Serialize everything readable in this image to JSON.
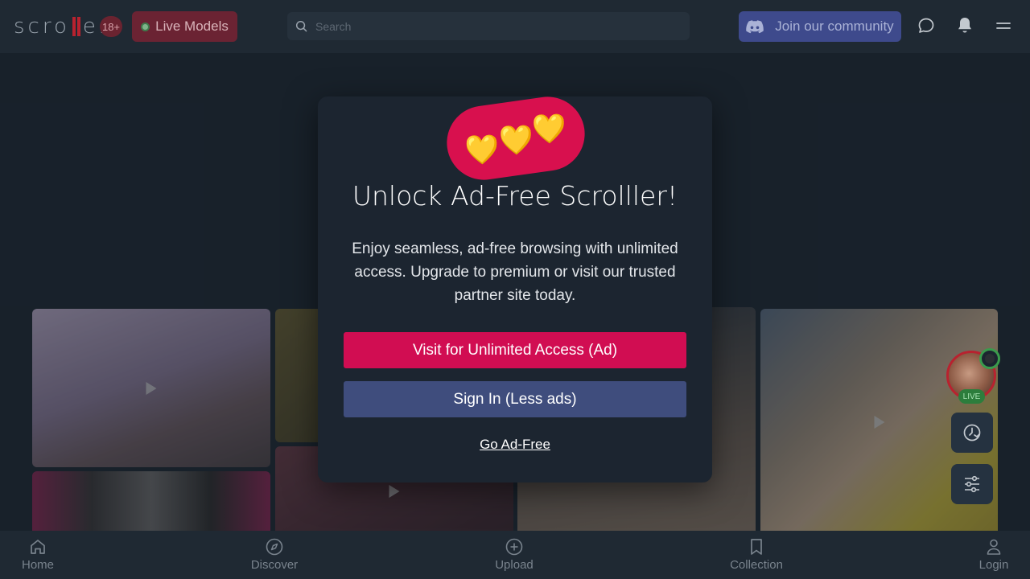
{
  "header": {
    "logo_left": "scro",
    "logo_right": "er",
    "age_badge": "18+",
    "live_models_label": "Live Models",
    "search_placeholder": "Search",
    "community_label": "Join our community"
  },
  "modal": {
    "hearts": [
      "💛",
      "💛",
      "💛"
    ],
    "title": "Unlock Ad-Free Scrolller!",
    "body": "Enjoy seamless, ad-free browsing with unlimited access. Upgrade to premium or visit our trusted partner site today.",
    "primary_button": "Visit for Unlimited Access (Ad)",
    "secondary_button": "Sign In (Less ads)",
    "link": "Go Ad-Free"
  },
  "side": {
    "live_label": "LIVE"
  },
  "bottom_nav": {
    "items": [
      {
        "label": "Home",
        "icon": "home-icon"
      },
      {
        "label": "Discover",
        "icon": "compass-icon"
      },
      {
        "label": "Upload",
        "icon": "plus-circle-icon"
      },
      {
        "label": "Collection",
        "icon": "bookmark-icon"
      },
      {
        "label": "Login",
        "icon": "user-icon"
      }
    ]
  },
  "colors": {
    "background": "#1c2530",
    "accent_pink": "#d10d52",
    "secondary_blue": "#3f4d7d",
    "brand_red": "#b8222f",
    "discord": "#3e4a8c"
  }
}
